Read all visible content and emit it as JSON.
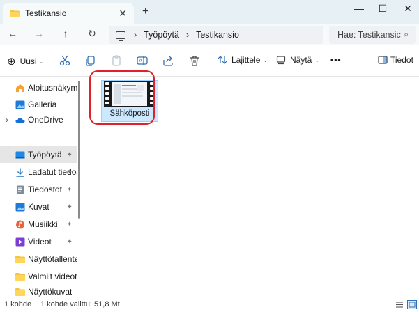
{
  "window": {
    "tab_title": "Testikansio",
    "tab_close": "✕",
    "new_tab": "+",
    "minimize": "—",
    "maximize": "☐",
    "close": "✕"
  },
  "nav": {
    "back": "←",
    "forward": "→",
    "up": "↑",
    "refresh": "↻",
    "breadcrumb": [
      "Työpöytä",
      "Testikansio"
    ],
    "crumb_sep": "›",
    "search_placeholder": "Hae: Testikansic",
    "search_icon": "⌕"
  },
  "toolbar": {
    "new_label": "Uusi",
    "new_icon": "⊕",
    "sort_label": "Lajittele",
    "view_label": "Näytä",
    "more_label": "•••",
    "details_label": "Tiedot",
    "chevron": "⌄"
  },
  "sidebar": {
    "top": [
      {
        "label": "Aloitusnäkymä",
        "icon": "home-icon"
      },
      {
        "label": "Galleria",
        "icon": "gallery-icon"
      },
      {
        "label": "OneDrive",
        "icon": "cloud-icon",
        "expand": "›"
      }
    ],
    "pinned": [
      {
        "label": "Työpöytä",
        "icon": "desktop-icon",
        "selected": true
      },
      {
        "label": "Ladatut tiedos",
        "icon": "download-icon"
      },
      {
        "label": "Tiedostot",
        "icon": "documents-icon"
      },
      {
        "label": "Kuvat",
        "icon": "pictures-icon"
      },
      {
        "label": "Musiikki",
        "icon": "music-icon"
      },
      {
        "label": "Videot",
        "icon": "videos-icon"
      },
      {
        "label": "Näyttötallenteet",
        "icon": "folder-icon"
      },
      {
        "label": "Valmiit videot",
        "icon": "folder-icon"
      },
      {
        "label": "Näyttökuvat",
        "icon": "folder-icon"
      }
    ],
    "pin_glyph": "📌"
  },
  "content": {
    "files": [
      {
        "name": "Sähköposti",
        "type": "video",
        "selected": true
      }
    ]
  },
  "status": {
    "count": "1 kohde",
    "selection": "1 kohde valittu: 51,8 Mt"
  },
  "colors": {
    "accent_red": "#e0202a",
    "selection": "#cce8ff",
    "titlebar": "#e7f0f4"
  }
}
